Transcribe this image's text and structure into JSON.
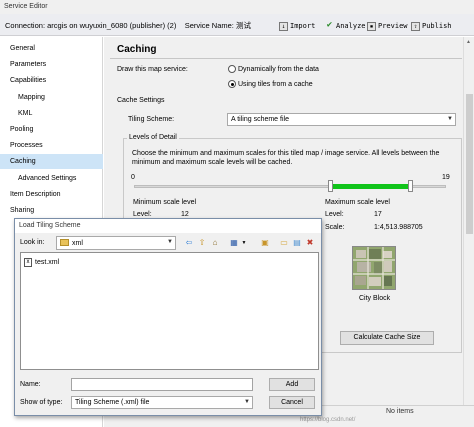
{
  "window": {
    "title": "Service Editor"
  },
  "toolbar": {
    "connection": "Connection: arcgis on wuyuxin_6080 (publisher) (2)",
    "service_name": "Service Name: 测试",
    "import_label": "Import",
    "analyze_label": "Analyze",
    "preview_label": "Preview",
    "publish_label": "Publish"
  },
  "sidebar": {
    "items": [
      {
        "label": "General"
      },
      {
        "label": "Parameters"
      },
      {
        "label": "Capabilities"
      },
      {
        "label": "Mapping"
      },
      {
        "label": "KML"
      },
      {
        "label": "Pooling"
      },
      {
        "label": "Processes"
      },
      {
        "label": "Caching"
      },
      {
        "label": "Advanced Settings"
      },
      {
        "label": "Item Description"
      },
      {
        "label": "Sharing"
      }
    ]
  },
  "main": {
    "heading": "Caching",
    "draw_label": "Draw this map service:",
    "radio_dynamic": "Dynamically from the data",
    "radio_tiles": "Using tiles from a cache",
    "cache_settings": "Cache Settings",
    "tiling_scheme_label": "Tiling Scheme:",
    "tiling_scheme_value": "A tiling scheme file",
    "lod_legend": "Levels of Detail",
    "lod_desc": "Choose the minimum and maximum scales for this tiled map / image service. All levels between the minimum and maximum scale levels will be cached.",
    "slider_min_label": "0",
    "slider_max_label": "19",
    "min_scale_title": "Minimum scale level",
    "min_level_label": "Level:",
    "min_level_value": "12",
    "max_scale_title": "Maximum scale level",
    "max_level_label": "Level:",
    "max_level_value": "17",
    "scale_label": "Scale:",
    "max_scale_value": "1:4,513.988705",
    "preview_caption": "City Block",
    "calc_button": "Calculate Cache Size",
    "no_items": "No items"
  },
  "dialog": {
    "title": "Load Tiling Scheme",
    "look_in_label": "Look in:",
    "look_in_value": "xml",
    "files": [
      "test.xml"
    ],
    "name_label": "Name:",
    "name_value": "",
    "type_label": "Show of type:",
    "type_value": "Tiling Scheme (.xml) file",
    "add_button": "Add",
    "cancel_button": "Cancel"
  },
  "watermark": "https://blog.csdn.net/"
}
